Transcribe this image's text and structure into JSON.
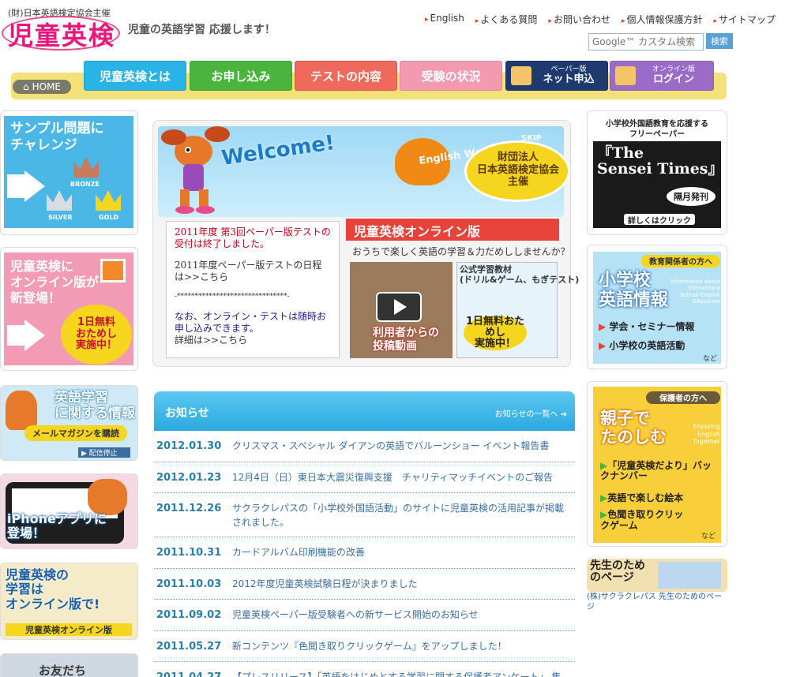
{
  "header": {
    "logo_sub": "(財)日本英語検定協会主催",
    "logo_main": "児童英検",
    "tagline": "児童の英語学習 応援します！",
    "links": [
      "English",
      "よくある質問",
      "お問い合わせ",
      "個人情報保護方針",
      "サイトマップ"
    ],
    "search_placeholder": "Google™ カスタム検索",
    "search_button": "検索"
  },
  "nav": {
    "home": "HOME",
    "tabs": [
      "児童英検とは",
      "お申し込み",
      "テストの内容",
      "受験の状況"
    ],
    "paper_small": "ペーパー版",
    "paper_main": "ネット申込",
    "online_small": "オンライン版",
    "online_main": "ログイン"
  },
  "left": {
    "sample_title": "サンプル問題に\nチャレンジ",
    "medals": [
      "BRONZE",
      "SILVER",
      "GOLD"
    ],
    "online_new": "児童英検に\nオンライン版が\n新登場！",
    "free_badge": "1日無料\nおためし\n実施中！",
    "mail_title": "英語学習\nに関する情報",
    "mail_button": "メールマガジンを購読",
    "mail_stop": "▶ 配信停止",
    "iphone": "iPhoneアプリに\n登場！",
    "learn_online": "児童英検の\n学習は\nオンライン版で!",
    "learn_online_footer": "児童英検オンライン版",
    "friend": "お友だち"
  },
  "center": {
    "welcome": "Welcome!",
    "skip": "SKIP",
    "balloon": "English World",
    "org": "財団法人\n日本英語検定協会\n主催",
    "notice_red": "2011年度 第3回ペーパー版テストの受付は終了しました。",
    "notice_schedule": "2011年度ペーパー版テストの日程は>>こちら",
    "notice_sep": "-*******************************-",
    "notice_online": "なお、オンライン・テストは随時お申し込みできます。",
    "notice_detail": "詳細は>>こちら",
    "online_title": "児童英検オンライン版",
    "online_sub": "おうちで楽しく英語の学習＆力だめししませんか？",
    "video_label": "利用者からの\n投稿動画",
    "material_title": "公式学習教材\n(ドリル&ゲーム、もぎテスト)",
    "material_badge": "1日無料おためし\n実施中！"
  },
  "news": {
    "title": "お知らせ",
    "more": "お知らせの一覧へ",
    "items": [
      {
        "date": "2012.01.30",
        "text": "クリスマス・スペシャル ダイアンの英語でバルーンショー イベント報告書"
      },
      {
        "date": "2012.01.23",
        "text": "12月4日（日）東日本大震災復興支援　チャリティマッチイベントのご報告"
      },
      {
        "date": "2011.12.26",
        "text": "サクラクレパスの「小学校外国語活動」のサイトに児童英検の活用記事が掲載されました。"
      },
      {
        "date": "2011.10.31",
        "text": "カードアルバム印刷機能の改善"
      },
      {
        "date": "2011.10.03",
        "text": "2012年度児童英検試験日程が決まりました"
      },
      {
        "date": "2011.09.02",
        "text": "児童英検ペーパー版受験者への新サービス開始のお知らせ"
      },
      {
        "date": "2011.05.27",
        "text": "新コンテンツ『色聞き取りクリックゲーム』をアップしました！"
      },
      {
        "date": "2011.04.27",
        "text": "【プレスリリース】「英語をはじめとする学習に関する保護者アンケート」 集"
      }
    ]
  },
  "right": {
    "sensei_top": "小学校外国語教育を応援する\nフリーペーパー",
    "sensei_title": "『The\nSensei Times』",
    "sensei_monthly": "隔月発刊",
    "sensei_more": "詳しくはクリック",
    "edu_tag": "教育関係者の方へ",
    "edu_title": "小学校\n英語情報",
    "edu_en": "Information about Elementary School English Education",
    "edu_items": [
      "学会・セミナー情報",
      "小学校の英語活動"
    ],
    "edu_more": "など",
    "parent_tag": "保護者の方へ",
    "parent_title": "親子で\nたのしむ",
    "parent_en": "Enjoying English Together",
    "parent_items": [
      "「児童英検だより」バックナンバー",
      "英語で楽しむ絵本",
      "色聞き取りクリックゲーム"
    ],
    "parent_more": "など",
    "teacher_banner": "先生のためのページ",
    "teacher_caption": "(株)サクラクレパス 先生のためのページ"
  },
  "colors": {
    "pink": "#e8177c",
    "sky": "#29b3e6",
    "green": "#4ab43c",
    "red": "#ef6a5c",
    "navy": "#1e3a6e"
  }
}
